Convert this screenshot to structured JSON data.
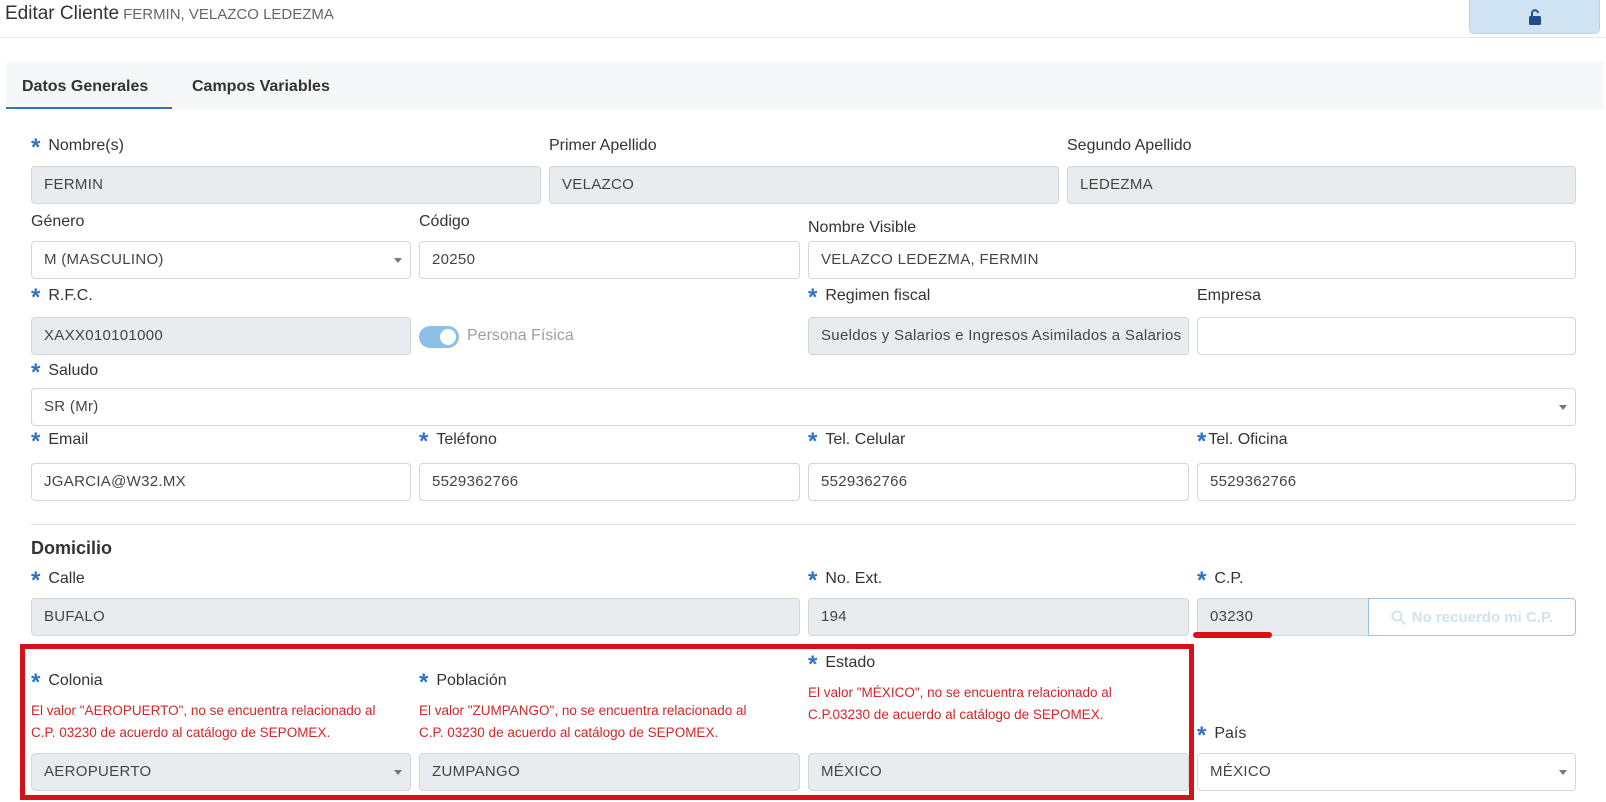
{
  "header": {
    "title": "Editar Cliente",
    "subtitle": "FERMIN, VELAZCO LEDEZMA",
    "lock_icon": "unlock-icon"
  },
  "tabs": [
    {
      "label": "Datos Generales",
      "active": true
    },
    {
      "label": "Campos Variables",
      "active": false
    }
  ],
  "form": {
    "nombre": {
      "label": "Nombre(s)",
      "value": "FERMIN"
    },
    "primer_apellido": {
      "label": "Primer Apellido",
      "value": "VELAZCO"
    },
    "segundo_apellido": {
      "label": "Segundo Apellido",
      "value": "LEDEZMA"
    },
    "genero": {
      "label": "Género",
      "value": "M (MASCULINO)"
    },
    "codigo": {
      "label": "Código",
      "value": "20250"
    },
    "nombre_visible": {
      "label": "Nombre Visible",
      "value": "VELAZCO LEDEZMA, FERMIN"
    },
    "rfc": {
      "label": "R.F.C.",
      "value": "XAXX010101000"
    },
    "persona_fisica": {
      "label": "Persona Física",
      "checked": true
    },
    "regimen_fiscal": {
      "label": "Regimen fiscal",
      "value": "Sueldos y Salarios e Ingresos Asimilados a Salarios"
    },
    "empresa": {
      "label": "Empresa",
      "value": ""
    },
    "saludo": {
      "label": "Saludo",
      "value": "SR (Mr)"
    },
    "email": {
      "label": "Email",
      "value": "JGARCIA@W32.MX"
    },
    "telefono": {
      "label": "Teléfono",
      "value": "5529362766"
    },
    "tel_celular": {
      "label": "Tel. Celular",
      "value": "5529362766"
    },
    "tel_oficina": {
      "label": "Tel. Oficina",
      "value": "5529362766"
    }
  },
  "domicilio": {
    "title": "Domicilio",
    "calle": {
      "label": "Calle",
      "value": "BUFALO"
    },
    "no_ext": {
      "label": "No. Ext.",
      "value": "194"
    },
    "cp": {
      "label": "C.P.",
      "value": "03230",
      "lookup_label": "No recuerdo mi C.P."
    },
    "colonia": {
      "label": "Colonia",
      "value": "AEROPUERTO",
      "error_line1": "El valor \"AEROPUERTO\", no se encuentra relacionado al",
      "error_line2": "C.P. 03230 de acuerdo al catálogo de SEPOMEX."
    },
    "poblacion": {
      "label": "Población",
      "value": "ZUMPANGO",
      "error_line1": "El valor \"ZUMPANGO\", no se encuentra relacionado al",
      "error_line2": "C.P. 03230 de acuerdo al catálogo de SEPOMEX."
    },
    "estado": {
      "label": "Estado",
      "value": "MÉXICO",
      "error_line1": "El valor \"MÉXICO\", no se encuentra relacionado al",
      "error_line2": "C.P.03230 de acuerdo al catálogo de SEPOMEX."
    },
    "pais": {
      "label": "País",
      "value": "MÉXICO"
    }
  },
  "colors": {
    "accent": "#2f73c6",
    "error": "#d32626",
    "highlight": "#d8101a"
  }
}
